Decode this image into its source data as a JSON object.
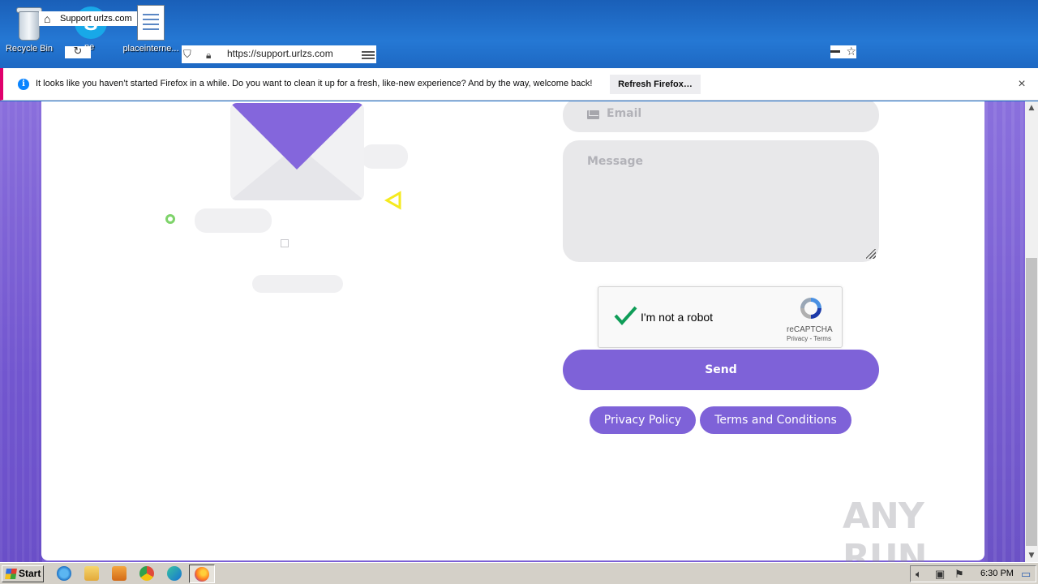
{
  "desktop": {
    "icons": [
      {
        "label": "Recycle Bin"
      },
      {
        "label": "pe"
      },
      {
        "label": "placeinterne..."
      }
    ]
  },
  "browser": {
    "tab_title": "Support urlzs.com",
    "url": "https://support.urlzs.com"
  },
  "notification": {
    "message": "It looks like you haven’t started Firefox in a while. Do you want to clean it up for a fresh, like-new experience? And by the way, welcome back!",
    "button_label": "Refresh Firefox…",
    "close_glyph": "×"
  },
  "form": {
    "email_placeholder": "Email",
    "message_placeholder": "Message",
    "captcha": {
      "label": "I'm not a robot",
      "brand": "reCAPTCHA",
      "links": "Privacy - Terms",
      "checked": true
    },
    "send_label": "Send",
    "privacy_label": "Privacy Policy",
    "terms_label": "Terms and Conditions"
  },
  "watermark": "ANY RUN",
  "taskbar": {
    "start_label": "Start",
    "clock": "6:30 PM",
    "apps": [
      "ie-icon",
      "folder-icon",
      "media-player-icon",
      "chrome-icon",
      "edge-icon",
      "firefox-icon"
    ]
  },
  "colors": {
    "accent": "#7e62d8",
    "page_bg": "#7b5fd6",
    "field_bg": "#e8e8ea",
    "notify_accent": "#e0006c",
    "info_blue": "#0a84ff"
  }
}
